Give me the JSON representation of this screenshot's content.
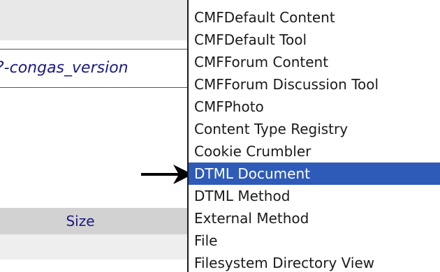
{
  "background_page": {
    "version_link": "?-congas_version",
    "size_column_header": "Size"
  },
  "add_list": {
    "selected_value": "DTML Document",
    "options": [
      "CMFDefault Content",
      "CMFDefault Tool",
      "CMFForum Content",
      "CMFForum Discussion Tool",
      "CMFPhoto",
      "Content Type Registry",
      "Cookie Crumbler",
      "DTML Document",
      "DTML Method",
      "External Method",
      "File",
      "Filesystem Directory View"
    ]
  },
  "colors": {
    "selection_background": "#2f5bb8",
    "selection_text": "#ffffff",
    "link_text": "#1a1a80"
  },
  "pointer": {
    "icon": "arrow-right-icon"
  }
}
